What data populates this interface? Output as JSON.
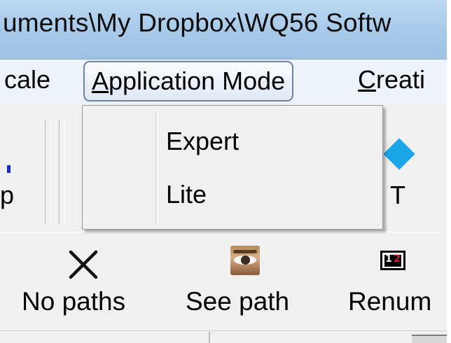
{
  "window": {
    "title": "uments\\My Dropbox\\WQ56 Softw"
  },
  "menubar": {
    "items": [
      {
        "label": "cale",
        "active": false
      },
      {
        "label": "Application Mode",
        "mnemonic": "A",
        "active": true
      },
      {
        "label": "Creati",
        "mnemonic": "C",
        "active": false
      }
    ]
  },
  "dropdown": {
    "items": [
      {
        "label": "Expert"
      },
      {
        "label": "Lite"
      }
    ]
  },
  "toolbar1": {
    "left_label": "p",
    "right_label": "T",
    "right_icon": "diamond-icon",
    "accent_color": "#1aa5e6"
  },
  "toolbar2": {
    "buttons": [
      {
        "label": "No paths",
        "icon": "x-icon"
      },
      {
        "label": "See path",
        "icon": "eye-icon"
      },
      {
        "label": "Renum",
        "icon": "renumber-icon"
      }
    ],
    "renum_digits": [
      "1",
      "2"
    ]
  }
}
